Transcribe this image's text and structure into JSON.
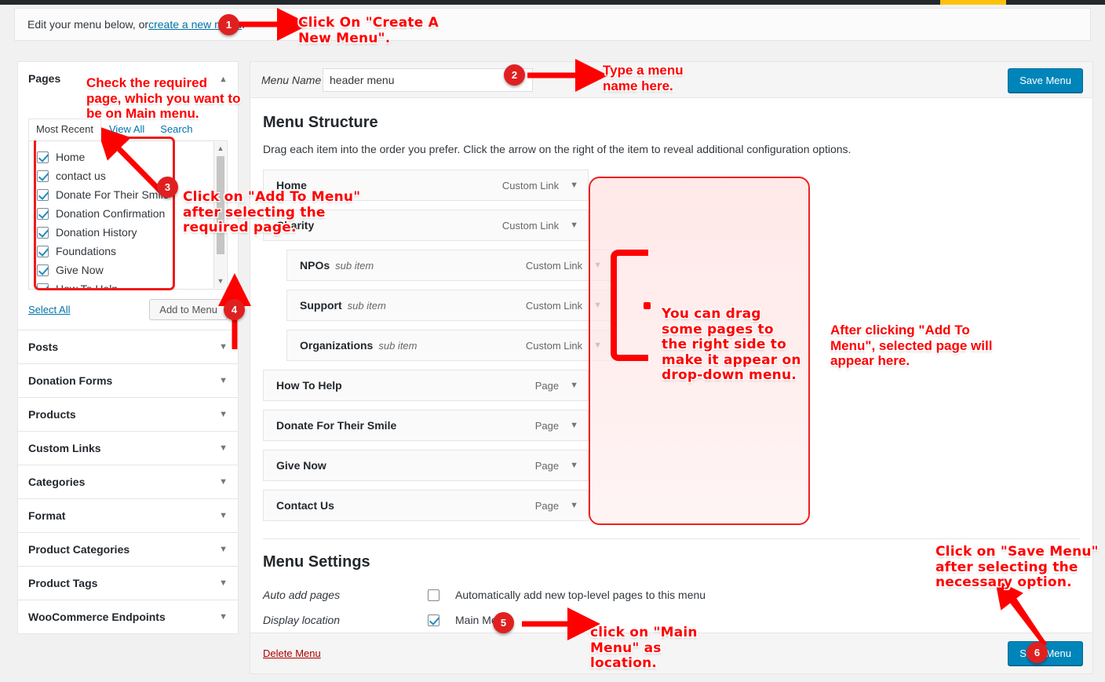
{
  "notice": {
    "text_before": "Edit your menu below, or ",
    "link": "create a new menu",
    "text_after": "."
  },
  "sidebar": {
    "pages_panel": {
      "title": "Pages",
      "caret": "chevron-up-icon",
      "tabs": [
        {
          "label": "Most Recent",
          "active": true
        },
        {
          "label": "View All",
          "active": false
        },
        {
          "label": "Search",
          "active": false
        }
      ],
      "items": [
        {
          "label": "Home",
          "checked": true
        },
        {
          "label": "contact us",
          "checked": true
        },
        {
          "label": "Donate For Their Smile",
          "checked": true
        },
        {
          "label": "Donation Confirmation",
          "checked": true
        },
        {
          "label": "Donation History",
          "checked": true
        },
        {
          "label": "Foundations",
          "checked": true
        },
        {
          "label": "Give Now",
          "checked": true
        },
        {
          "label": "How To Help",
          "checked": true
        }
      ],
      "select_all": "Select All",
      "add_to_menu": "Add to Menu"
    },
    "accordion": [
      {
        "label": "Posts"
      },
      {
        "label": "Donation Forms"
      },
      {
        "label": "Products"
      },
      {
        "label": "Custom Links"
      },
      {
        "label": "Categories"
      },
      {
        "label": "Format"
      },
      {
        "label": "Product Categories"
      },
      {
        "label": "Product Tags"
      },
      {
        "label": "WooCommerce Endpoints"
      }
    ]
  },
  "main": {
    "menu_name_label": "Menu Name",
    "menu_name_value": "header menu",
    "menu_name_placeholder": "Menu Name",
    "save_menu_top": "Save Menu",
    "save_menu_bottom": "Save Menu",
    "structure_title": "Menu Structure",
    "structure_help": "Drag each item into the order you prefer. Click the arrow on the right of the item to reveal additional configuration options.",
    "menu_items": [
      {
        "title": "Home",
        "sub_label": "",
        "type": "Custom Link",
        "depth": 0
      },
      {
        "title": "Charity",
        "sub_label": "",
        "type": "Custom Link",
        "depth": 0
      },
      {
        "title": "NPOs",
        "sub_label": "sub item",
        "type": "Custom Link",
        "depth": 1
      },
      {
        "title": "Support",
        "sub_label": "sub item",
        "type": "Custom Link",
        "depth": 1
      },
      {
        "title": "Organizations",
        "sub_label": "sub item",
        "type": "Custom Link",
        "depth": 1
      },
      {
        "title": "How To Help",
        "sub_label": "",
        "type": "Page",
        "depth": 0
      },
      {
        "title": "Donate For Their Smile",
        "sub_label": "",
        "type": "Page",
        "depth": 0
      },
      {
        "title": "Give Now",
        "sub_label": "",
        "type": "Page",
        "depth": 0
      },
      {
        "title": "Contact Us",
        "sub_label": "",
        "type": "Page",
        "depth": 0
      }
    ],
    "settings": {
      "title": "Menu Settings",
      "auto_add_label": "Auto add pages",
      "auto_add_text": "Automatically add new top-level pages to this menu",
      "auto_add_checked": false,
      "display_location_label": "Display location",
      "display_location_text": "Main Menu",
      "display_location_checked": true
    },
    "delete_menu": "Delete Menu"
  },
  "annotations": {
    "a1": "Click On \"Create A\nNew Menu\".",
    "a2": "Type a menu\nname here.",
    "a3": "Check the required\npage, which you want to\nbe on Main menu.",
    "a4": "Click on \"Add To Menu\"\nafter selecting the\nrequired page.",
    "a5": "You can drag\nsome pages to\nthe right side to\nmake it appear on\ndrop-down menu.",
    "a6": "After clicking \"Add To\nMenu\", selected page will\nappear here.",
    "a7": "click on \"Main\nMenu\" as\nlocation.",
    "a8": "Click on \"Save Menu\"\nafter selecting the\nnecessary option.",
    "badges": [
      "1",
      "2",
      "3",
      "4",
      "5",
      "6"
    ],
    "accent_color": "#ff0000",
    "badge_color": "#e02020"
  }
}
